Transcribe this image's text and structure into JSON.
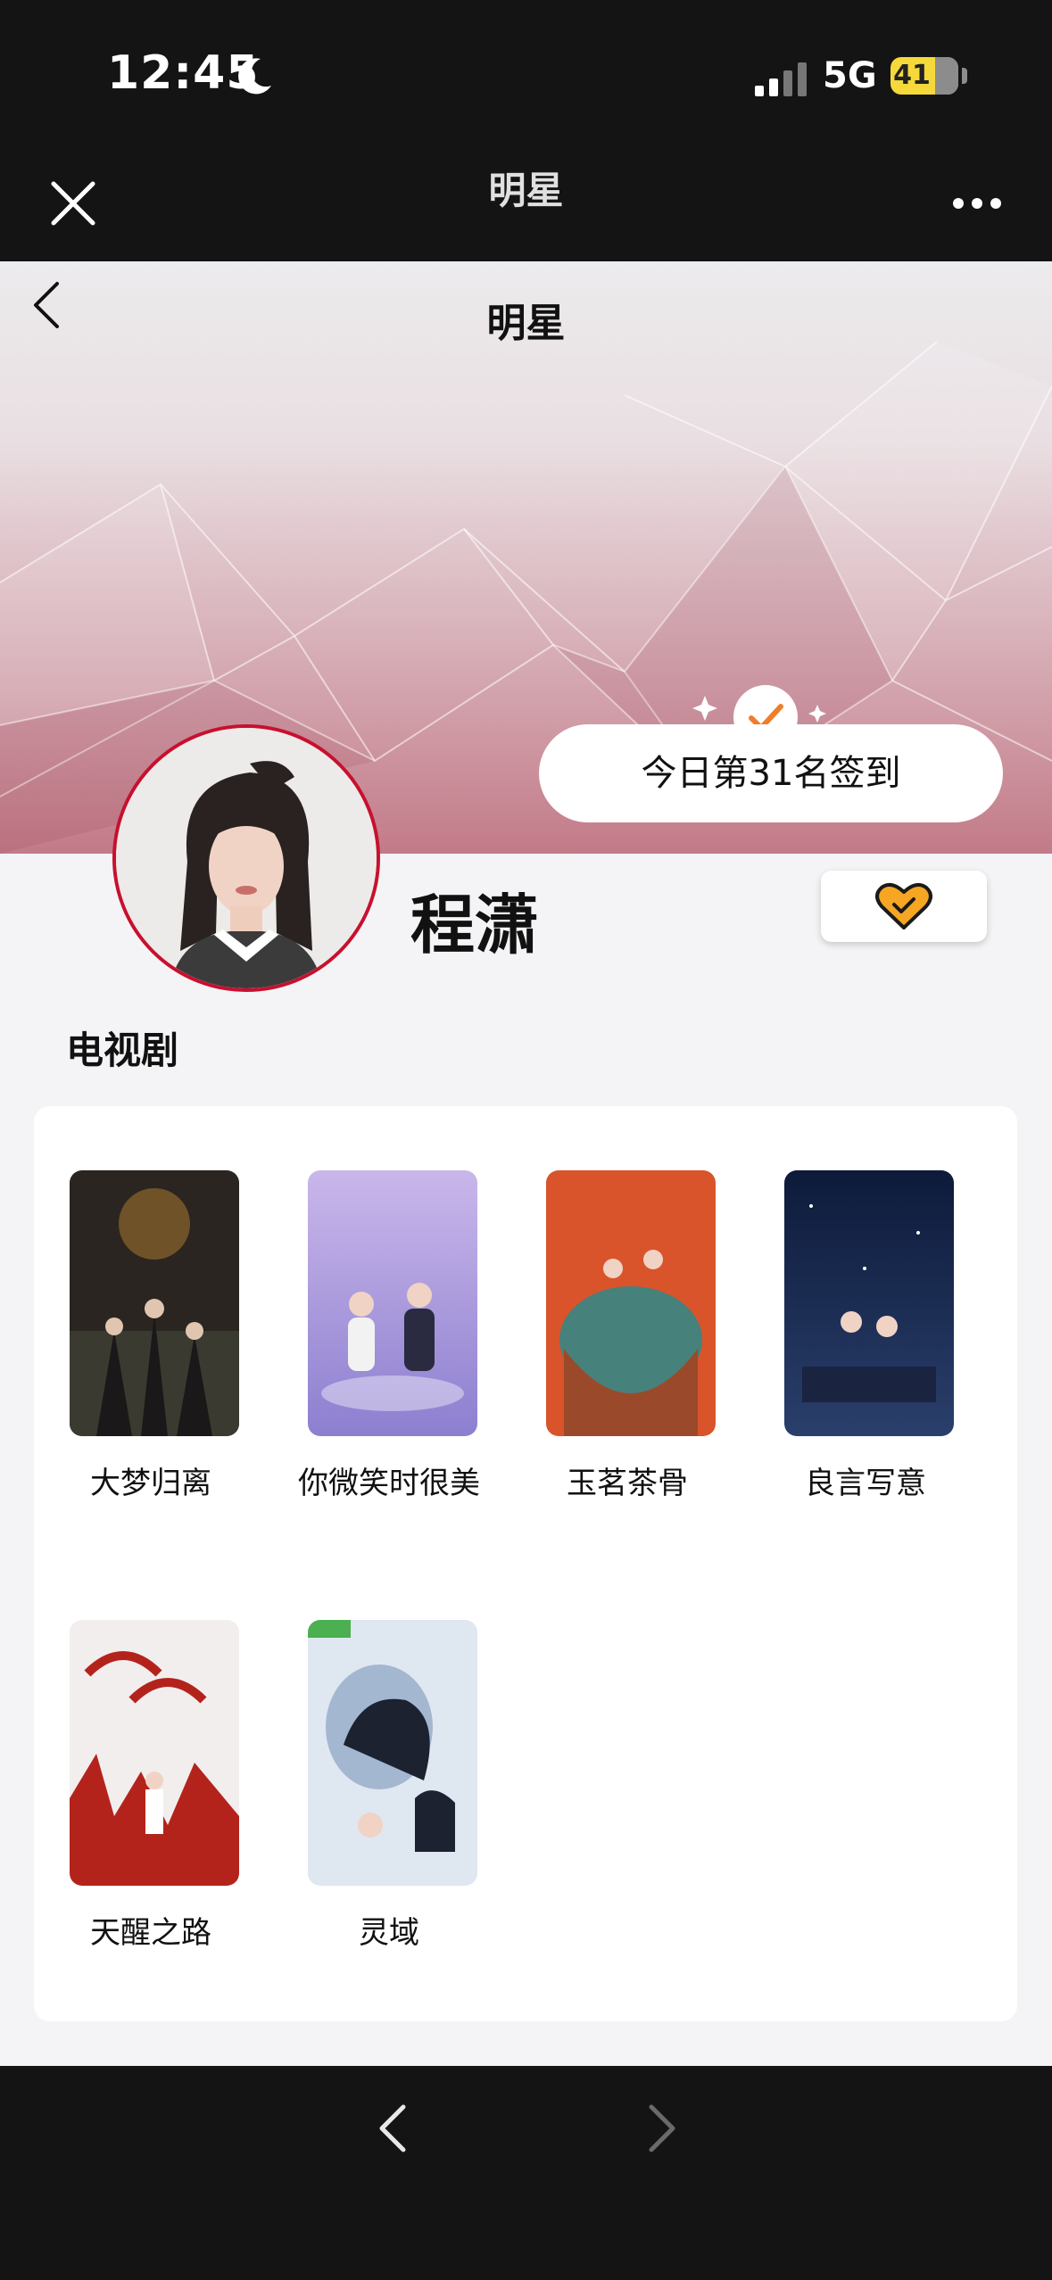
{
  "status_bar": {
    "time": "12:45",
    "network": "5G",
    "battery": "41"
  },
  "mini_program_bar": {
    "title": "明星"
  },
  "header": {
    "title": "明星"
  },
  "checkin": {
    "text": "今日第31名签到"
  },
  "star": {
    "name": "程潇"
  },
  "section": {
    "title": "电视剧"
  },
  "dramas": [
    {
      "title": "大梦归离",
      "poster_colors": [
        "#2a2520",
        "#4a3a2a"
      ]
    },
    {
      "title": "你微笑时很美",
      "poster_colors": [
        "#9d8fd6",
        "#c9b7ea"
      ]
    },
    {
      "title": "玉茗茶骨",
      "poster_colors": [
        "#d9542a",
        "#2b8a8a"
      ]
    },
    {
      "title": "良言写意",
      "poster_colors": [
        "#0d1a3a",
        "#2a3f6b"
      ]
    },
    {
      "title": "天醒之路",
      "poster_colors": [
        "#f2eeee",
        "#b3231c"
      ]
    },
    {
      "title": "灵域",
      "poster_colors": [
        "#dfe7f0",
        "#8aa3c2"
      ]
    }
  ],
  "colors": {
    "accent": "#c8102e",
    "check": "#f07d2a",
    "heart": "#f6a623"
  }
}
